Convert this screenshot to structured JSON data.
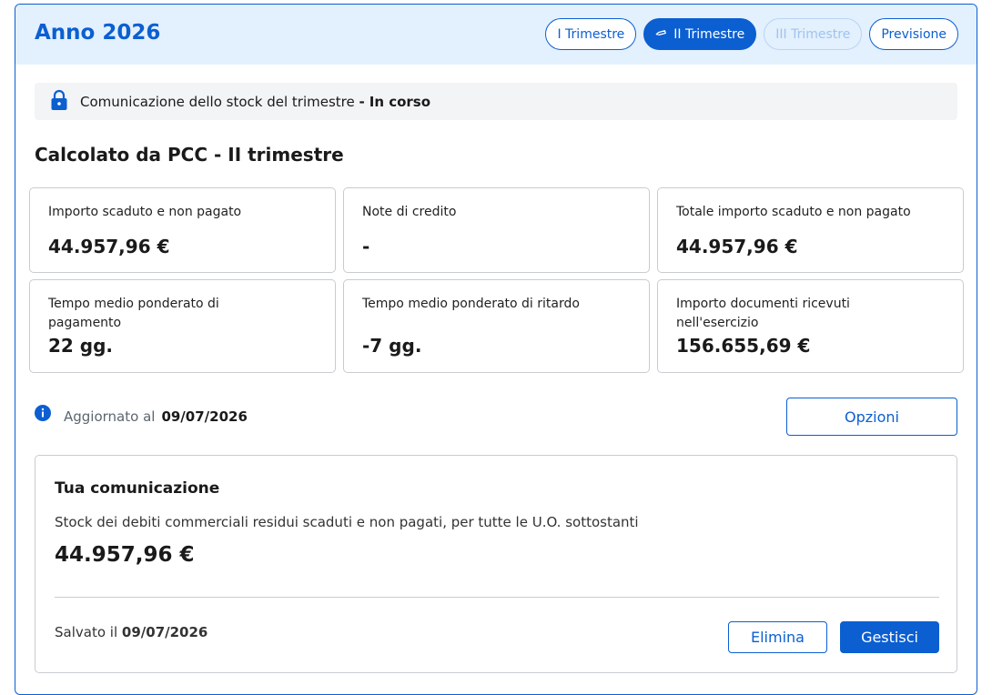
{
  "header": {
    "title": "Anno 2026",
    "tabs": [
      {
        "label": "I Trimestre",
        "state": "default"
      },
      {
        "label": "II Trimestre",
        "state": "active",
        "icon": "pencil-icon"
      },
      {
        "label": "III Trimestre",
        "state": "disabled"
      },
      {
        "label": "Previsione",
        "state": "default"
      }
    ]
  },
  "notice": {
    "icon": "lock-icon",
    "text": "Comunicazione dello stock del trimestre",
    "separator": "-",
    "status": "In corso"
  },
  "section": {
    "title": "Calcolato da PCC - II trimestre"
  },
  "cards": [
    {
      "label": "Importo scaduto e non pagato",
      "value": "44.957,96 €"
    },
    {
      "label": "Note di credito",
      "value": "-"
    },
    {
      "label": "Totale importo scaduto e non pagato",
      "value": "44.957,96 €"
    },
    {
      "label": "Tempo medio ponderato di pagamento",
      "value": "22 gg."
    },
    {
      "label": "Tempo medio ponderato di ritardo",
      "value": "-7 gg."
    },
    {
      "label": "Importo documenti ricevuti nell'esercizio",
      "value": "156.655,69 €"
    }
  ],
  "updated": {
    "icon": "info-icon",
    "label": "Aggiornato al",
    "date": "09/07/2026"
  },
  "options_label": "Opzioni",
  "communication": {
    "title": "Tua comunicazione",
    "description": "Stock dei debiti commerciali residui scaduti e non pagati, per tutte le U.O. sottostanti",
    "amount": "44.957,96 €",
    "saved_label": "Salvato il",
    "saved_date": "09/07/2026",
    "delete_label": "Elimina",
    "manage_label": "Gestisci"
  },
  "colors": {
    "primary": "#0b5fd1",
    "header_bg": "#e3f0fd",
    "notice_bg": "#f3f4f5",
    "border": "#c8ccd0"
  }
}
